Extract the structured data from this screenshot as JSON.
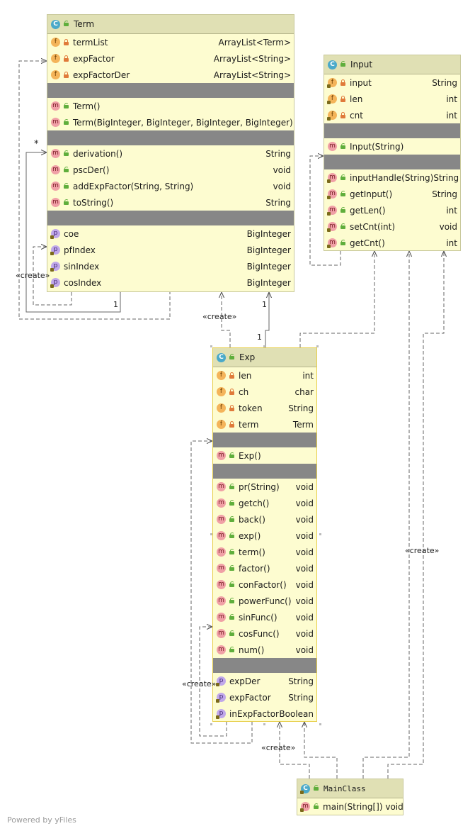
{
  "classes": {
    "term": {
      "badge": "C",
      "name": "Term",
      "fields": [
        {
          "name": "termList",
          "type": "ArrayList<Term>"
        },
        {
          "name": "expFactor",
          "type": "ArrayList<String>"
        },
        {
          "name": "expFactorDer",
          "type": "ArrayList<String>"
        }
      ],
      "constructors": [
        {
          "name": "Term()"
        },
        {
          "name": "Term(BigInteger, BigInteger, BigInteger, BigInteger)"
        }
      ],
      "methods": [
        {
          "name": "derivation()",
          "type": "String"
        },
        {
          "name": "pscDer()",
          "type": "void"
        },
        {
          "name": "addExpFactor(String, String)",
          "type": "void"
        },
        {
          "name": "toString()",
          "type": "String"
        }
      ],
      "properties": [
        {
          "name": "coe",
          "type": "BigInteger"
        },
        {
          "name": "pfIndex",
          "type": "BigInteger"
        },
        {
          "name": "sinIndex",
          "type": "BigInteger"
        },
        {
          "name": "cosIndex",
          "type": "BigInteger"
        }
      ]
    },
    "input": {
      "badge": "C",
      "name": "Input",
      "fields": [
        {
          "name": "input",
          "type": "String"
        },
        {
          "name": "len",
          "type": "int"
        },
        {
          "name": "cnt",
          "type": "int"
        }
      ],
      "constructors": [
        {
          "name": "Input(String)"
        }
      ],
      "methods": [
        {
          "name": "inputHandle(String)",
          "type": "String"
        },
        {
          "name": "getInput()",
          "type": "String"
        },
        {
          "name": "getLen()",
          "type": "int"
        },
        {
          "name": "setCnt(int)",
          "type": "void"
        },
        {
          "name": "getCnt()",
          "type": "int"
        }
      ]
    },
    "exp": {
      "badge": "C",
      "name": "Exp",
      "fields": [
        {
          "name": "len",
          "type": "int"
        },
        {
          "name": "ch",
          "type": "char"
        },
        {
          "name": "token",
          "type": "String"
        },
        {
          "name": "term",
          "type": "Term"
        }
      ],
      "constructors": [
        {
          "name": "Exp()"
        }
      ],
      "methods": [
        {
          "name": "pr(String)",
          "type": "void"
        },
        {
          "name": "getch()",
          "type": "void"
        },
        {
          "name": "back()",
          "type": "void"
        },
        {
          "name": "exp()",
          "type": "void"
        },
        {
          "name": "term()",
          "type": "void"
        },
        {
          "name": "factor()",
          "type": "void"
        },
        {
          "name": "conFactor()",
          "type": "void"
        },
        {
          "name": "powerFunc()",
          "type": "void"
        },
        {
          "name": "sinFunc()",
          "type": "void"
        },
        {
          "name": "cosFunc()",
          "type": "void"
        },
        {
          "name": "num()",
          "type": "void"
        }
      ],
      "properties": [
        {
          "name": "expDer",
          "type": "String"
        },
        {
          "name": "expFactor",
          "type": "String"
        },
        {
          "name": "inExpFactor",
          "type": "Boolean"
        }
      ]
    },
    "main": {
      "badge": "C",
      "name": "MainClass",
      "methods": [
        {
          "name": "main(String[]) void",
          "type": ""
        }
      ]
    }
  },
  "edge_labels": {
    "term_create_self": "«create»",
    "term_star": "*",
    "term_comp_one": "1",
    "exp_create_term": "«create»",
    "term_one": "1",
    "exp_one": "1",
    "exp_create_self": "«create»",
    "main_create_input": "«create»",
    "main_create_exp": "«create»"
  },
  "footer": "Powered by yFiles",
  "colors": {
    "class_fill": "#fdfcd0",
    "class_header": "#e0e0b4",
    "separator": "#878787",
    "selected_border": "#e7cf4a",
    "edge": "#555555"
  }
}
